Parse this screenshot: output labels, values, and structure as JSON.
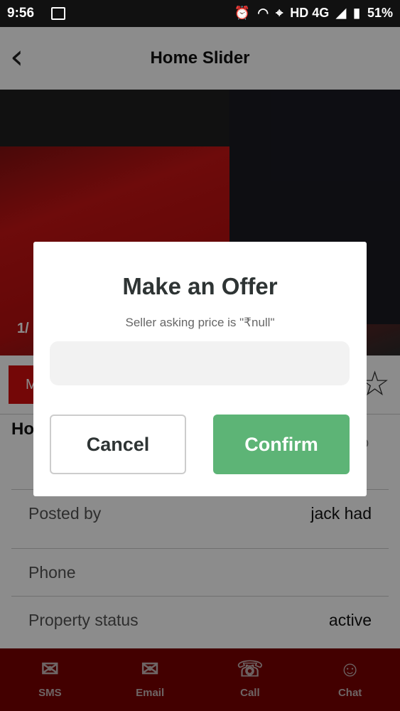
{
  "status_bar": {
    "time": "9:56",
    "network": "HD 4G",
    "battery": "51%"
  },
  "appbar": {
    "title": "Home Slider",
    "back_icon": "back-chevron-icon"
  },
  "hero": {
    "counter": "1/"
  },
  "listing": {
    "tab_fragment": "M",
    "heading_fragment": "Ho",
    "right_fragment": "o",
    "rows": [
      {
        "label": "Posted by",
        "value": "jack had"
      },
      {
        "label": "Phone",
        "value": ""
      },
      {
        "label": "Property status",
        "value": "active"
      }
    ]
  },
  "bottom_nav": [
    {
      "label": "SMS",
      "icon": "sms-icon"
    },
    {
      "label": "Email",
      "icon": "email-icon"
    },
    {
      "label": "Call",
      "icon": "call-icon"
    },
    {
      "label": "Chat",
      "icon": "chat-icon"
    }
  ],
  "dialog": {
    "title": "Make an Offer",
    "subtitle": "Seller asking price is \"₹null\"",
    "input_value": "",
    "cancel_label": "Cancel",
    "confirm_label": "Confirm"
  },
  "colors": {
    "accent_red": "#d40d0d",
    "confirm_green": "#5db476",
    "nav_bg": "#7a0000"
  }
}
